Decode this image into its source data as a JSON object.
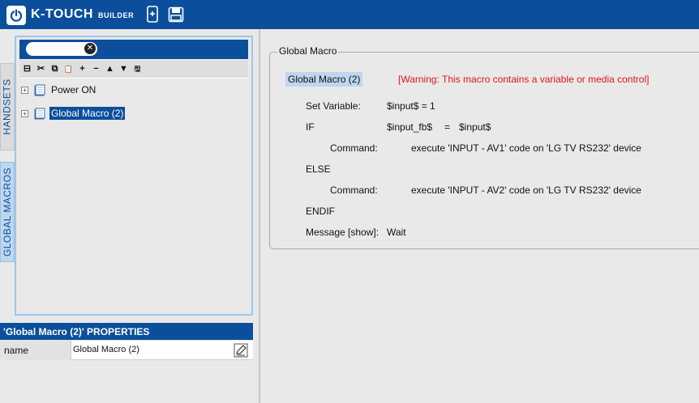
{
  "app": {
    "brand": "K-TOUCH",
    "brand_sub": "BUILDER",
    "accent_color": "#0b4f9c",
    "icons": [
      "power-logo-icon",
      "add-device-icon",
      "save-icon"
    ]
  },
  "side_tabs": [
    {
      "label": "HANDSETS",
      "active": false
    },
    {
      "label": "GLOBAL MACROS",
      "active": true
    }
  ],
  "tree": {
    "search_value": "",
    "toolbar_icons": [
      "collapse-icon",
      "cut-icon",
      "copy-icon",
      "paste-icon",
      "add-icon",
      "remove-icon",
      "move-up-icon",
      "move-down-icon",
      "save-icon"
    ],
    "toolbar_glyphs": [
      "⊟",
      "✂",
      "⧉",
      "📋",
      "+",
      "−",
      "▲",
      "▼",
      "🖫"
    ],
    "items": [
      {
        "label": "Power ON",
        "selected": false
      },
      {
        "label": "Global Macro (2)",
        "selected": true
      }
    ]
  },
  "properties": {
    "header": "'Global Macro (2)' PROPERTIES",
    "rows": [
      {
        "name": "name",
        "value": "Global Macro (2)"
      }
    ]
  },
  "macro": {
    "legend": "Global Macro",
    "title": "Global Macro (2)",
    "warning": "[Warning: This macro contains a variable or media control]",
    "warning_color": "#e0141b",
    "set_variable": {
      "label": "Set Variable:",
      "value": "$input$ = 1"
    },
    "if": {
      "label": "IF",
      "left": "$input_fb$",
      "op": "=",
      "right": "$input$"
    },
    "command1": {
      "label": "Command:",
      "value": "execute 'INPUT - AV1' code on 'LG TV RS232' device"
    },
    "else_label": "ELSE",
    "command2": {
      "label": "Command:",
      "value": "execute 'INPUT - AV2' code on 'LG TV RS232' device"
    },
    "endif_label": "ENDIF",
    "message": {
      "label": "Message [show]:",
      "value": "Wait"
    }
  }
}
